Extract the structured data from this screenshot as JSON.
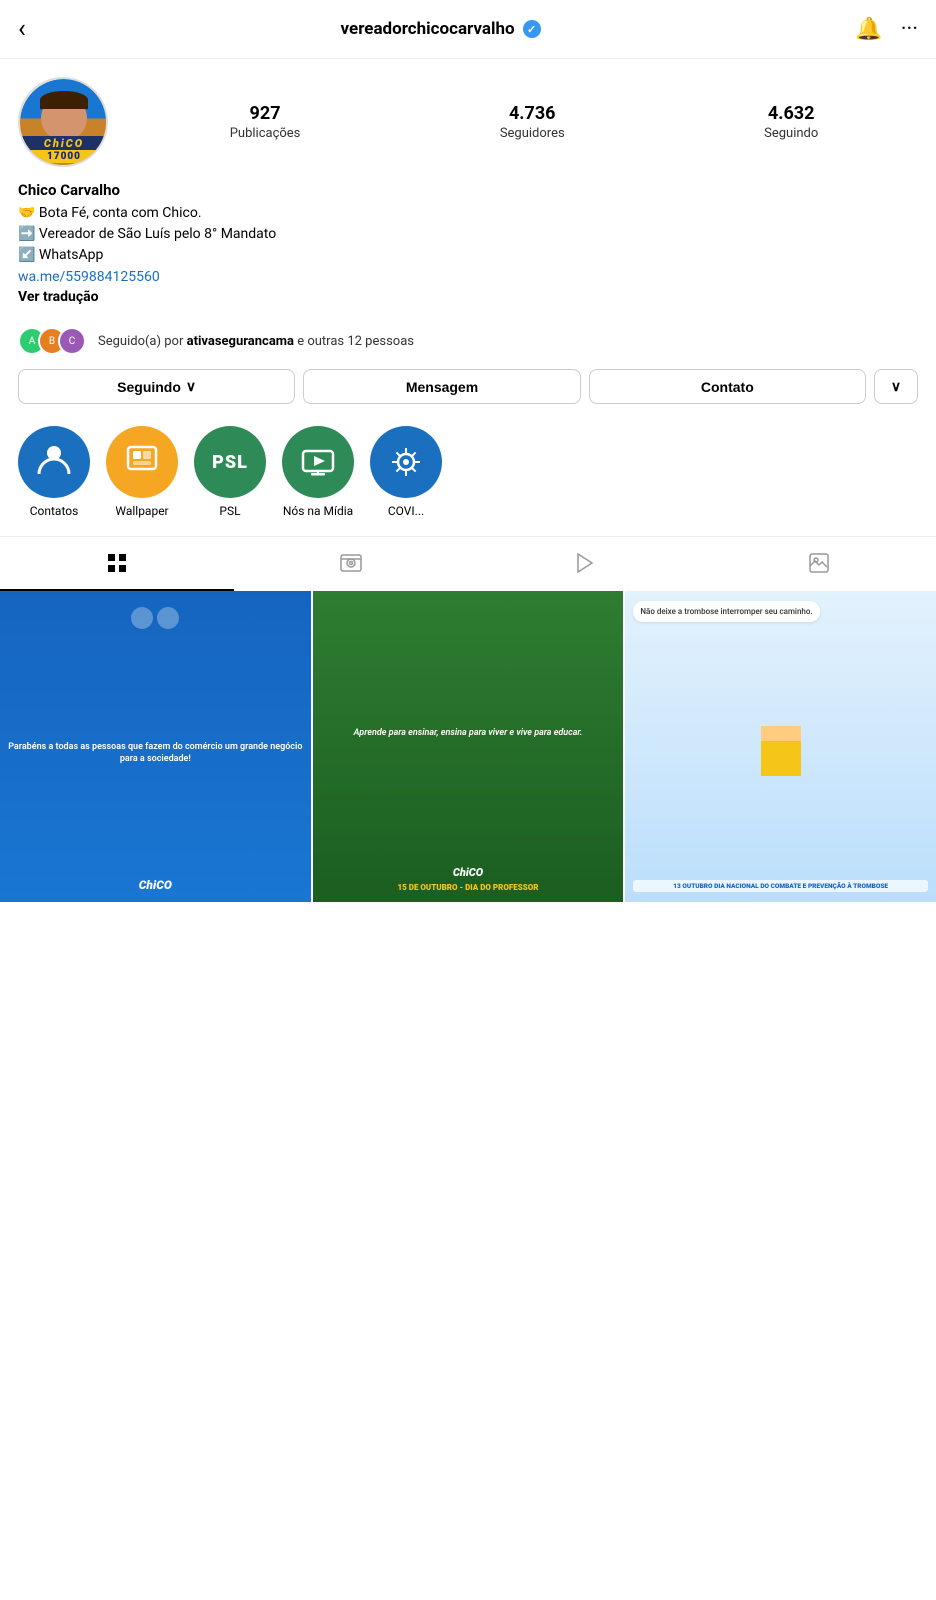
{
  "header": {
    "username": "vereadorchicocarvalho",
    "back_label": "‹",
    "more_label": "···"
  },
  "stats": {
    "posts_count": "927",
    "posts_label": "Publicações",
    "followers_count": "4.736",
    "followers_label": "Seguidores",
    "following_count": "4.632",
    "following_label": "Seguindo"
  },
  "bio": {
    "name": "Chico Carvalho",
    "line1": "🤝 Bota Fé, conta com Chico.",
    "line2": "➡️ Vereador de São Luís pelo 8° Mandato",
    "line3": "↙️ WhatsApp",
    "link": "wa.me/559884125560",
    "translate": "Ver tradução"
  },
  "followed_by": {
    "text": "Seguido(a) por ",
    "bold_name": "ativasegurancama",
    "suffix": " e outras 12 pessoas"
  },
  "buttons": {
    "following": "Seguindo",
    "message": "Mensagem",
    "contact": "Contato",
    "expand": "∨"
  },
  "highlights": [
    {
      "id": 1,
      "label": "Contatos",
      "color": "#1a6fbf",
      "icon": "👤"
    },
    {
      "id": 2,
      "label": "Wallpaper",
      "color": "#f5a623",
      "icon": "🖼"
    },
    {
      "id": 3,
      "label": "PSL",
      "color": "#2e8b57",
      "icon": "PSL"
    },
    {
      "id": 4,
      "label": "Nós na Mídia",
      "color": "#2e8b57",
      "icon": "📺"
    },
    {
      "id": 5,
      "label": "COVI...",
      "color": "#1a6fbf",
      "icon": "🦠"
    }
  ],
  "tabs": [
    {
      "id": "grid",
      "active": true
    },
    {
      "id": "reels"
    },
    {
      "id": "tv"
    },
    {
      "id": "tagged"
    }
  ],
  "posts": [
    {
      "id": 1,
      "text": "Parabéns a todas as pessoas que fazem do comércio um grande negócio para a sociedade!",
      "caption": "",
      "type": "blue"
    },
    {
      "id": 2,
      "text": "Aprende para ensinar, ensina para viver e vive para educar.",
      "caption": "15 DE OUTUBRO - DIA DO PROFESSOR",
      "type": "green"
    },
    {
      "id": 3,
      "bubble": "Não deixe a trombose interromper seu caminho.",
      "caption": "13 OUTUBRO DIA NACIONAL DO COMBATE E PREVENÇÃO À TROMBOSE",
      "type": "light"
    }
  ]
}
